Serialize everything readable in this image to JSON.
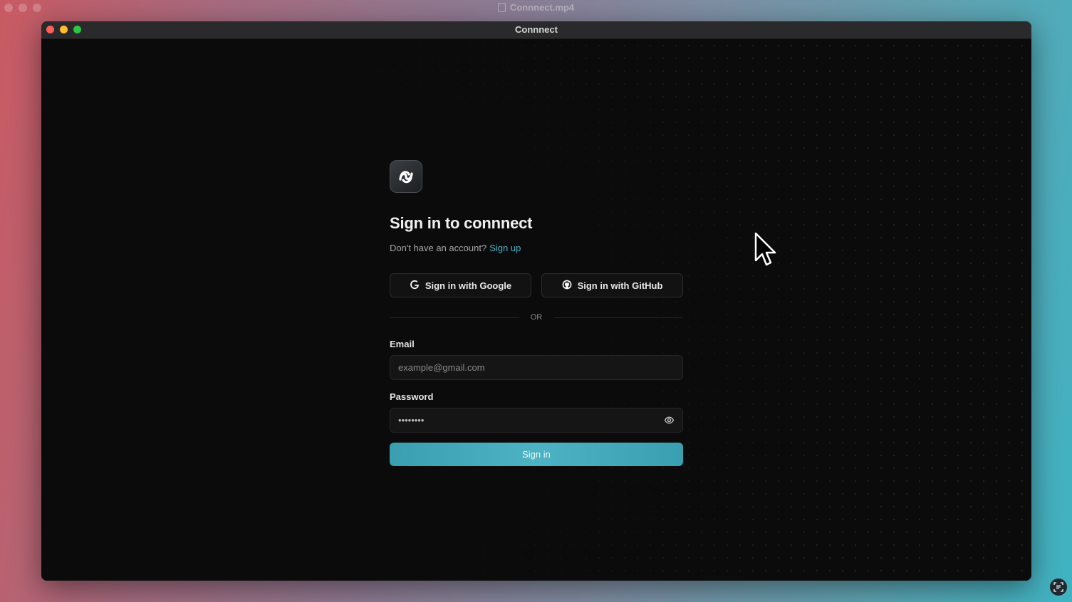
{
  "outer": {
    "title": "Connnect.mp4"
  },
  "window": {
    "title": "Connnect"
  },
  "login": {
    "heading": "Sign in to connnect",
    "no_account_text": "Don't have an account?",
    "signup_link": "Sign up",
    "google_button": "Sign in with Google",
    "github_button": "Sign in with GitHub",
    "divider_text": "OR",
    "email_label": "Email",
    "email_placeholder": "example@gmail.com",
    "password_label": "Password",
    "password_value": "••••••••",
    "submit_button": "Sign in"
  },
  "colors": {
    "accent": "#4db3c4",
    "window_bg": "#0a0a0a",
    "close": "#ff5f57",
    "minimize": "#febc2e",
    "maximize": "#28c840"
  },
  "icons": [
    "app-logo-icon",
    "google-icon",
    "github-icon",
    "eye-icon",
    "cursor-icon",
    "screen-capture-icon"
  ]
}
